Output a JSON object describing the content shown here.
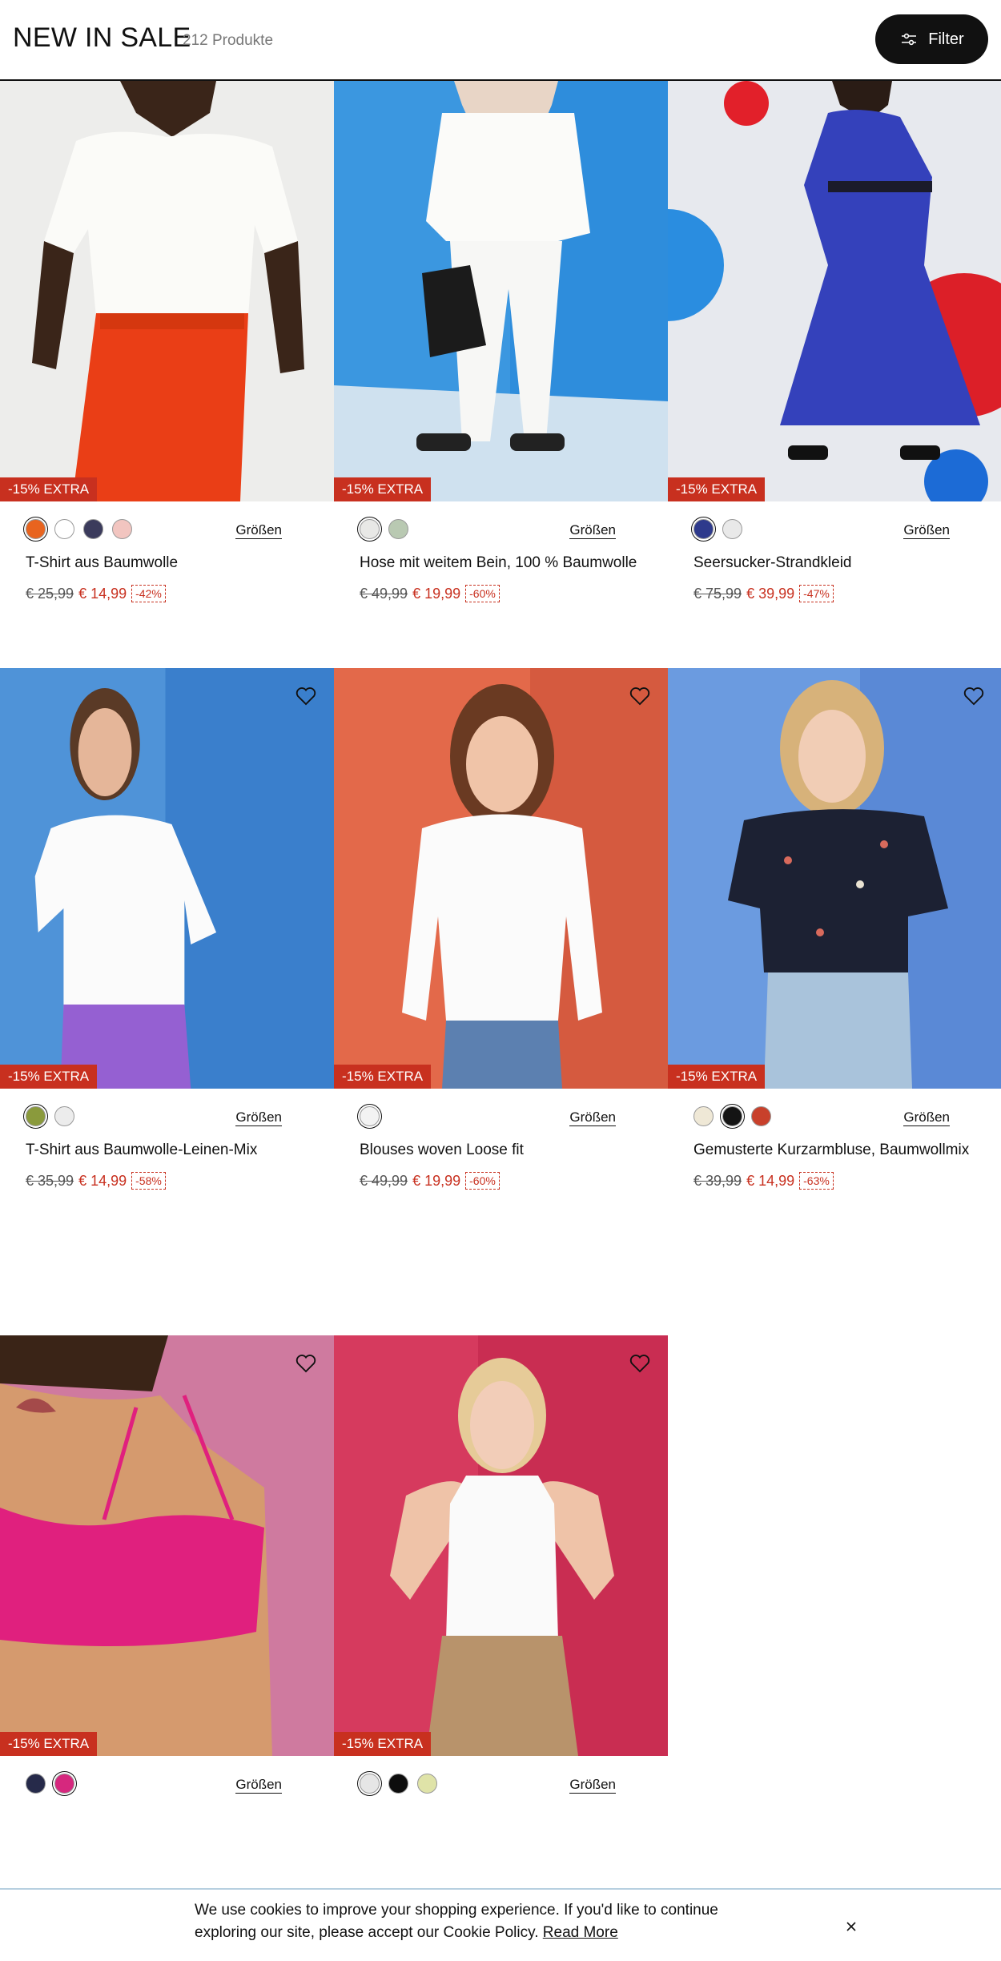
{
  "header": {
    "title": "NEW IN SALE",
    "count": "212 Produkte",
    "filter_label": "Filter"
  },
  "products": [
    {
      "name": "T-Shirt aus Baumwolle",
      "badge": "-15% EXTRA",
      "sizes_label": "Größen",
      "old_price": "€ 25,99",
      "new_price": "€ 14,99",
      "discount": "-42%",
      "swatches": [
        "#e8641f",
        "#ffffff",
        "#3b3b5c",
        "#f2c5c0"
      ],
      "selected_swatch": 0
    },
    {
      "name": "Hose mit weitem Bein, 100 % Baumwolle",
      "badge": "-15% EXTRA",
      "sizes_label": "Größen",
      "old_price": "€ 49,99",
      "new_price": "€ 19,99",
      "discount": "-60%",
      "swatches": [
        "#e8e8e6",
        "#b9c9b2"
      ],
      "selected_swatch": 0
    },
    {
      "name": "Seersucker-Strandkleid",
      "badge": "-15% EXTRA",
      "sizes_label": "Größen",
      "old_price": "€ 75,99",
      "new_price": "€ 39,99",
      "discount": "-47%",
      "swatches": [
        "#2e3a8c",
        "#e9e9e9"
      ],
      "selected_swatch": 0
    },
    {
      "name": "T-Shirt aus Baumwolle-Leinen-Mix",
      "badge": "-15% EXTRA",
      "sizes_label": "Größen",
      "old_price": "€ 35,99",
      "new_price": "€ 14,99",
      "discount": "-58%",
      "swatches": [
        "#8a9a3c",
        "#ececec"
      ],
      "selected_swatch": 0
    },
    {
      "name": "Blouses woven Loose fit",
      "badge": "-15% EXTRA",
      "sizes_label": "Größen",
      "old_price": "€ 49,99",
      "new_price": "€ 19,99",
      "discount": "-60%",
      "swatches": [
        "#f3f3f3"
      ],
      "selected_swatch": 0
    },
    {
      "name": "Gemusterte Kurzarmbluse, Baumwollmix",
      "badge": "-15% EXTRA",
      "sizes_label": "Größen",
      "old_price": "€ 39,99",
      "new_price": "€ 14,99",
      "discount": "-63%",
      "swatches": [
        "#efe8d6",
        "#141414",
        "#c8402b"
      ],
      "selected_swatch": 1
    },
    {
      "name": "",
      "badge": "-15% EXTRA",
      "sizes_label": "Größen",
      "swatches": [
        "#262a4a",
        "#d6287e"
      ],
      "selected_swatch": 1
    },
    {
      "name": "",
      "badge": "-15% EXTRA",
      "sizes_label": "Größen",
      "swatches": [
        "#e6e6e6",
        "#0d0d0d",
        "#dfe3a8"
      ],
      "selected_swatch": 0
    }
  ],
  "icons": {
    "filter": "sliders-icon",
    "wishlist": "heart-icon",
    "close": "close-icon"
  },
  "colors": {
    "sale_red": "#c8301f",
    "black": "#111111"
  },
  "cookie": {
    "text": "We use cookies to improve your shopping experience. If you'd like to continue exploring our site, please accept our Cookie Policy.",
    "link": "Read More"
  }
}
